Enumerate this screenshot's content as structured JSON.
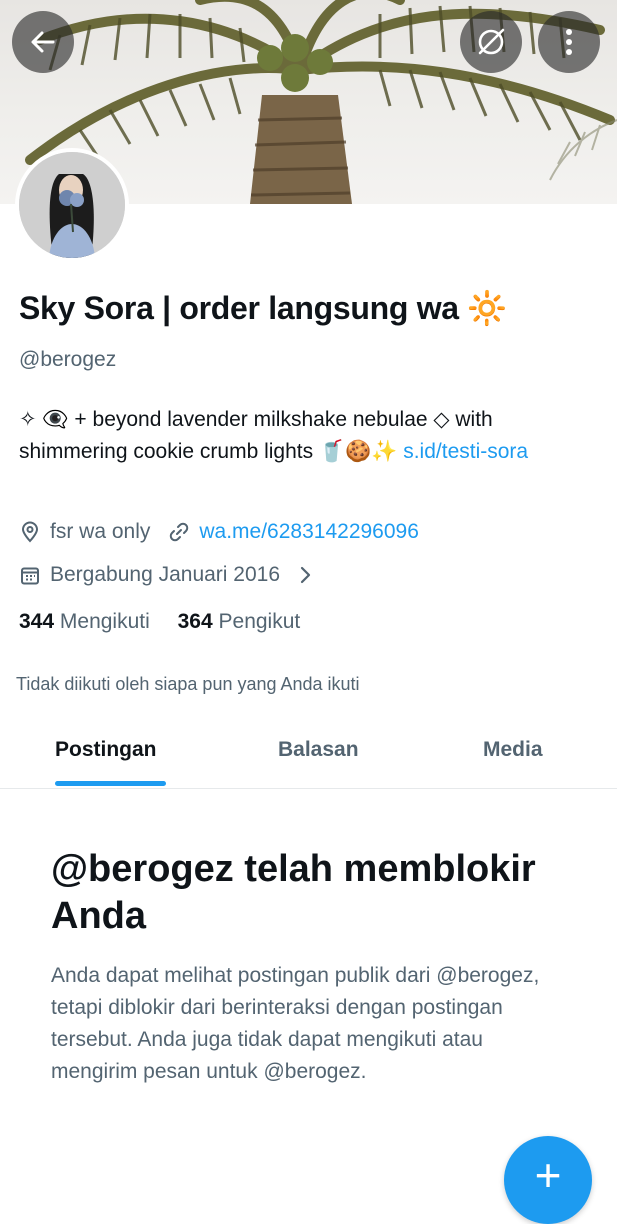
{
  "header": {
    "back_icon": "arrow-left-icon",
    "hide_icon": "eye-off-icon",
    "more_icon": "more-vertical-icon"
  },
  "profile": {
    "name": "Sky Sora | order langsung wa 🔆",
    "handle": "@berogez",
    "bio_text": "✧ 👁‍🗨 + beyond lavender milkshake nebulae ◇ with shimmering cookie crumb lights 🥤🍪✨ ",
    "bio_link": "s.id/testi-sora",
    "location": "fsr wa only",
    "website": "wa.me/6283142296096",
    "joined": "Bergabung Januari 2016",
    "following_count": "344",
    "following_label": "Mengikuti",
    "followers_count": "364",
    "followers_label": "Pengikut",
    "not_followed_note": "Tidak diikuti oleh siapa pun yang Anda ikuti"
  },
  "tabs": [
    {
      "label": "Postingan",
      "active": true
    },
    {
      "label": "Balasan",
      "active": false
    },
    {
      "label": "Media",
      "active": false
    }
  ],
  "blocked": {
    "title": "@berogez telah memblokir Anda",
    "description": "Anda dapat melihat postingan publik dari @berogez, tetapi diblokir dari berinteraksi dengan postingan tersebut. Anda juga tidak dapat mengikuti atau mengirim pesan untuk @berogez."
  },
  "fab": {
    "label": "+"
  },
  "colors": {
    "accent": "#1d9bf0",
    "text_primary": "#0f1419",
    "text_secondary": "#536471"
  }
}
